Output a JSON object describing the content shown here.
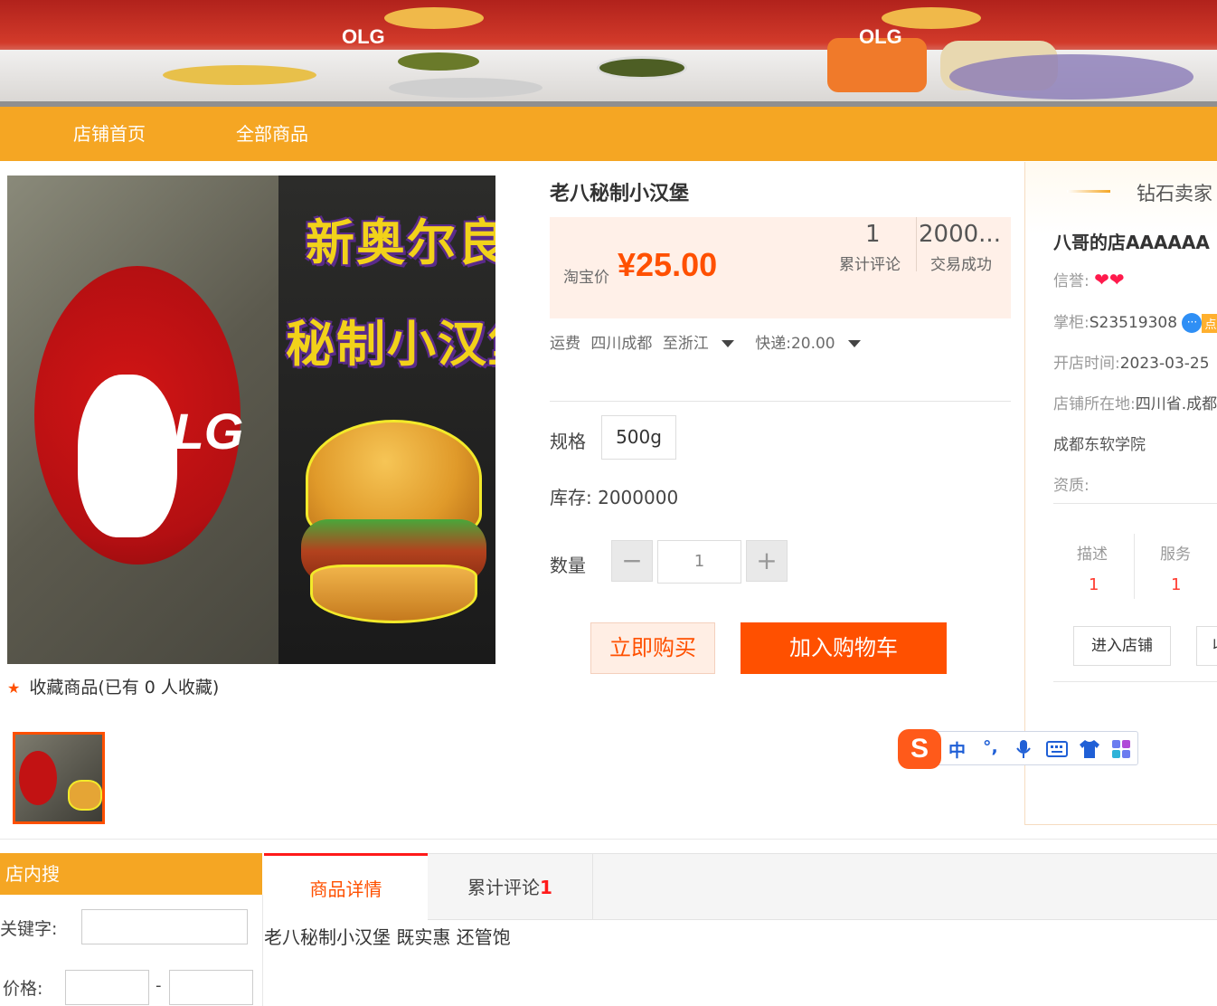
{
  "banner": {
    "brand_text": "OLG"
  },
  "nav": {
    "items": [
      "店铺首页",
      "全部商品"
    ]
  },
  "product": {
    "image_text_line1": "新奥尔良",
    "image_text_line2": "秘制小汉堡",
    "image_logo": "OLG",
    "favorite_text": "收藏商品(已有 0 人收藏)",
    "title": "老八秘制小汉堡",
    "price_label": "淘宝价",
    "price": "¥25.00",
    "reviews_count": "1",
    "reviews_label": "累计评论",
    "deals_count": "2000...",
    "deals_label": "交易成功",
    "shipping": {
      "label": "运费",
      "from": "四川成都",
      "to": "至浙江",
      "express": "快递:20.00"
    },
    "spec_label": "规格",
    "spec_value": "500g",
    "stock_label": "库存:",
    "stock_value": "2000000",
    "qty_label": "数量",
    "qty_value": "1",
    "minus": "−",
    "plus": "+",
    "buy_now": "立即购买",
    "add_to_cart": "加入购物车"
  },
  "seller": {
    "badge": "钻石卖家",
    "shop_name": "八哥的店AAAAAA",
    "credit_label": "信誉:",
    "hearts": "❤❤",
    "keeper_label": "掌柜:",
    "keeper_value": "S23519308",
    "chat_icon": "···",
    "chat_tag": "点",
    "open_label": "开店时间:",
    "open_value": "2023-03-25",
    "location_label": "店铺所在地:",
    "location_value": "四川省.成都",
    "location_line2": "成都东软学院",
    "qualification_label": "资质:",
    "desc_label": "描述",
    "desc_value": "1",
    "service_label": "服务",
    "service_value": "1",
    "enter_shop": "进入店铺",
    "collect_shop": "收"
  },
  "ime": {
    "logo": "S",
    "mode": "中",
    "punct": "°,",
    "icons": [
      "microphone-icon",
      "keyboard-icon",
      "shirt-icon",
      "apps-icon"
    ]
  },
  "shop_search": {
    "title": "店内搜",
    "keyword_label": "关键字:",
    "price_label": "价格:",
    "dash": "-"
  },
  "tabs": {
    "detail": "商品详情",
    "reviews": "累计评论",
    "reviews_count": "1"
  },
  "description": "老八秘制小汉堡 既实惠 还管饱"
}
